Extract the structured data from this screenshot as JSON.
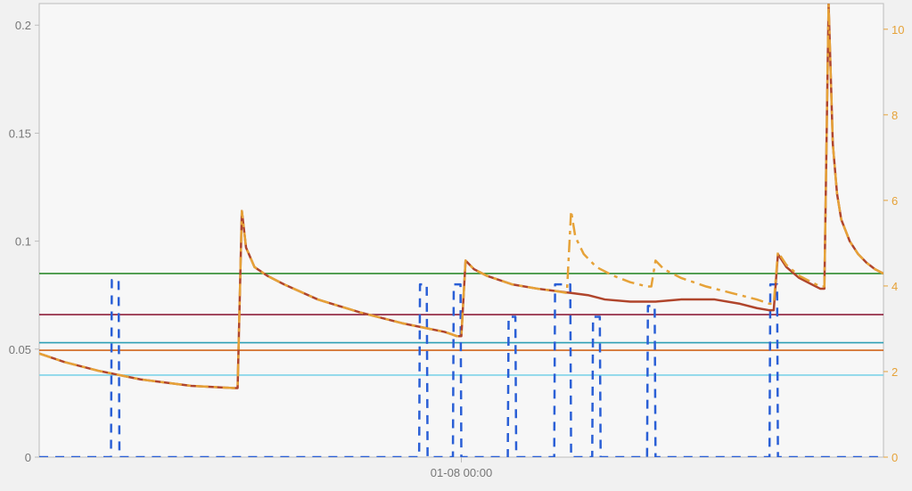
{
  "chart_data": {
    "type": "line",
    "title": "",
    "xlabel": "",
    "ylabel_left": "",
    "ylabel_right": "",
    "x_range": [
      0,
      100
    ],
    "x_ticks": [
      {
        "x": 50,
        "label": "01-08 00:00"
      }
    ],
    "y_left": {
      "range": [
        0,
        0.21
      ],
      "ticks": [
        0,
        0.05,
        0.1,
        0.15,
        0.2
      ]
    },
    "y_right": {
      "range": [
        0,
        10.6
      ],
      "ticks": [
        0,
        2,
        4,
        6,
        8,
        10
      ]
    },
    "hlines_left": [
      {
        "value": 0.085,
        "color": "#2e8b2e"
      },
      {
        "value": 0.066,
        "color": "#8e1f3a"
      },
      {
        "value": 0.053,
        "color": "#2e9fb5"
      },
      {
        "value": 0.0495,
        "color": "#d1661c"
      },
      {
        "value": 0.038,
        "color": "#7fd4e8"
      }
    ],
    "series": [
      {
        "name": "blue-dashed",
        "axis": "left",
        "color": "#2a5fd6",
        "style": "dashed",
        "width": 2.5,
        "data": [
          [
            0,
            0
          ],
          [
            8.5,
            0
          ],
          [
            8.6,
            0.082
          ],
          [
            9.4,
            0.082
          ],
          [
            9.5,
            0
          ],
          [
            45,
            0
          ],
          [
            45.1,
            0.08
          ],
          [
            45.9,
            0.08
          ],
          [
            46,
            0
          ],
          [
            49,
            0
          ],
          [
            49.1,
            0.08
          ],
          [
            49.9,
            0.08
          ],
          [
            50,
            0
          ],
          [
            55.5,
            0
          ],
          [
            55.6,
            0.065
          ],
          [
            56.4,
            0.065
          ],
          [
            56.5,
            0
          ],
          [
            61,
            0
          ],
          [
            61.1,
            0.08
          ],
          [
            62.9,
            0.08
          ],
          [
            63,
            0
          ],
          [
            65.5,
            0
          ],
          [
            65.6,
            0.065
          ],
          [
            66.4,
            0.065
          ],
          [
            66.5,
            0
          ],
          [
            72,
            0
          ],
          [
            72.1,
            0.07
          ],
          [
            72.9,
            0.07
          ],
          [
            73,
            0
          ],
          [
            86.5,
            0
          ],
          [
            86.6,
            0.08
          ],
          [
            87.4,
            0.08
          ],
          [
            87.5,
            0
          ],
          [
            100,
            0
          ]
        ]
      },
      {
        "name": "brown-solid",
        "axis": "left",
        "color": "#b0452c",
        "style": "solid",
        "width": 2.5,
        "data": [
          [
            0,
            0.048
          ],
          [
            3,
            0.044
          ],
          [
            7,
            0.04
          ],
          [
            12,
            0.036
          ],
          [
            18,
            0.033
          ],
          [
            23,
            0.032
          ],
          [
            23.5,
            0.032
          ],
          [
            24,
            0.114
          ],
          [
            24.5,
            0.097
          ],
          [
            25.5,
            0.088
          ],
          [
            27,
            0.084
          ],
          [
            29,
            0.08
          ],
          [
            33,
            0.073
          ],
          [
            38,
            0.067
          ],
          [
            43,
            0.062
          ],
          [
            48,
            0.058
          ],
          [
            49.5,
            0.056
          ],
          [
            50,
            0.056
          ],
          [
            50.5,
            0.091
          ],
          [
            51.5,
            0.087
          ],
          [
            53,
            0.084
          ],
          [
            56,
            0.08
          ],
          [
            59,
            0.078
          ],
          [
            61,
            0.077
          ],
          [
            63,
            0.076
          ],
          [
            65,
            0.075
          ],
          [
            67,
            0.073
          ],
          [
            70,
            0.072
          ],
          [
            73,
            0.072
          ],
          [
            76,
            0.073
          ],
          [
            80,
            0.073
          ],
          [
            83,
            0.071
          ],
          [
            85,
            0.069
          ],
          [
            86.5,
            0.068
          ],
          [
            87,
            0.068
          ],
          [
            87.5,
            0.094
          ],
          [
            88.5,
            0.088
          ],
          [
            90,
            0.083
          ],
          [
            91.5,
            0.08
          ],
          [
            92.5,
            0.078
          ],
          [
            93,
            0.078
          ],
          [
            93.5,
            0.21
          ],
          [
            94,
            0.145
          ],
          [
            94.5,
            0.122
          ],
          [
            95,
            0.11
          ],
          [
            96,
            0.1
          ],
          [
            97,
            0.094
          ],
          [
            98,
            0.09
          ],
          [
            99,
            0.087
          ],
          [
            100,
            0.085
          ]
        ]
      },
      {
        "name": "yellow-dashdot",
        "axis": "left",
        "color": "#e6a238",
        "style": "dashdot",
        "width": 2.5,
        "data": [
          [
            0,
            0.048
          ],
          [
            3,
            0.044
          ],
          [
            7,
            0.04
          ],
          [
            12,
            0.036
          ],
          [
            18,
            0.033
          ],
          [
            23,
            0.032
          ],
          [
            23.5,
            0.032
          ],
          [
            24,
            0.114
          ],
          [
            24.5,
            0.097
          ],
          [
            25.5,
            0.088
          ],
          [
            27,
            0.084
          ],
          [
            29,
            0.08
          ],
          [
            33,
            0.073
          ],
          [
            38,
            0.067
          ],
          [
            43,
            0.062
          ],
          [
            48,
            0.058
          ],
          [
            49.5,
            0.056
          ],
          [
            50,
            0.056
          ],
          [
            50.5,
            0.091
          ],
          [
            51.5,
            0.087
          ],
          [
            53,
            0.084
          ],
          [
            56,
            0.08
          ],
          [
            59,
            0.078
          ],
          [
            61,
            0.077
          ],
          [
            62.5,
            0.076
          ],
          [
            63,
            0.114
          ],
          [
            63.5,
            0.102
          ],
          [
            64.5,
            0.094
          ],
          [
            66,
            0.088
          ],
          [
            68,
            0.084
          ],
          [
            70,
            0.081
          ],
          [
            72,
            0.079
          ],
          [
            72.5,
            0.079
          ],
          [
            73,
            0.091
          ],
          [
            74,
            0.087
          ],
          [
            76,
            0.083
          ],
          [
            79,
            0.079
          ],
          [
            82,
            0.076
          ],
          [
            85,
            0.073
          ],
          [
            86.5,
            0.071
          ],
          [
            87,
            0.071
          ],
          [
            87.5,
            0.095
          ],
          [
            88.5,
            0.089
          ],
          [
            90,
            0.084
          ],
          [
            91.5,
            0.081
          ],
          [
            92.5,
            0.079
          ],
          [
            93,
            0.079
          ],
          [
            93.5,
            0.21
          ],
          [
            94,
            0.145
          ],
          [
            94.5,
            0.122
          ],
          [
            95,
            0.11
          ],
          [
            96,
            0.1
          ],
          [
            97,
            0.094
          ],
          [
            98,
            0.09
          ],
          [
            99,
            0.087
          ],
          [
            100,
            0.085
          ]
        ]
      }
    ]
  }
}
